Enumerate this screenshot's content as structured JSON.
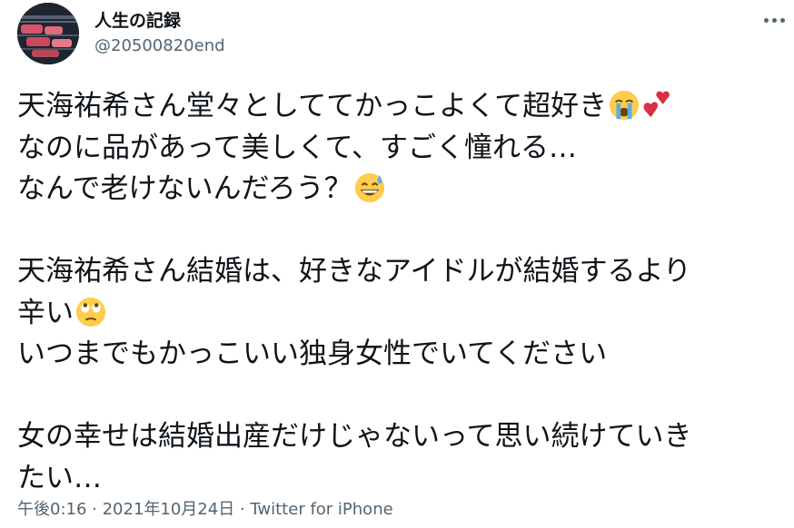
{
  "author": {
    "display_name": "人生の記録",
    "handle": "@20500820end",
    "avatar_icon": "profile-photo"
  },
  "more_icon": "more-horizontal-icon",
  "tweet": {
    "lines": [
      {
        "text": "天海祐希さん堂々としててかっこよくて超好き",
        "emojis": [
          "loudly-crying-face",
          "heart-exclamation"
        ]
      },
      {
        "text": "なのに品があって美しくて、すごく憧れる…",
        "emojis": []
      },
      {
        "text": "なんで老けないんだろう？",
        "emojis": [
          "grinning-face-with-sweat"
        ]
      },
      {
        "blank": true
      },
      {
        "text": "天海祐希さん結婚は、好きなアイドルが結婚するより",
        "emojis": []
      },
      {
        "text": "辛い",
        "emojis": [
          "face-with-rolling-eyes"
        ]
      },
      {
        "text": "いつまでもかっこいい独身女性でいてください",
        "emojis": []
      },
      {
        "blank": true
      },
      {
        "text": "女の幸せは結婚出産だけじゃないって思い続けていき",
        "emojis": []
      },
      {
        "text": "たい…",
        "emojis": []
      }
    ]
  },
  "footer": {
    "time": "午後0:16",
    "separator": " · ",
    "date": "2021年10月24日",
    "source": "Twitter for iPhone"
  },
  "colors": {
    "text": "#0f1419",
    "secondary": "#536471"
  }
}
